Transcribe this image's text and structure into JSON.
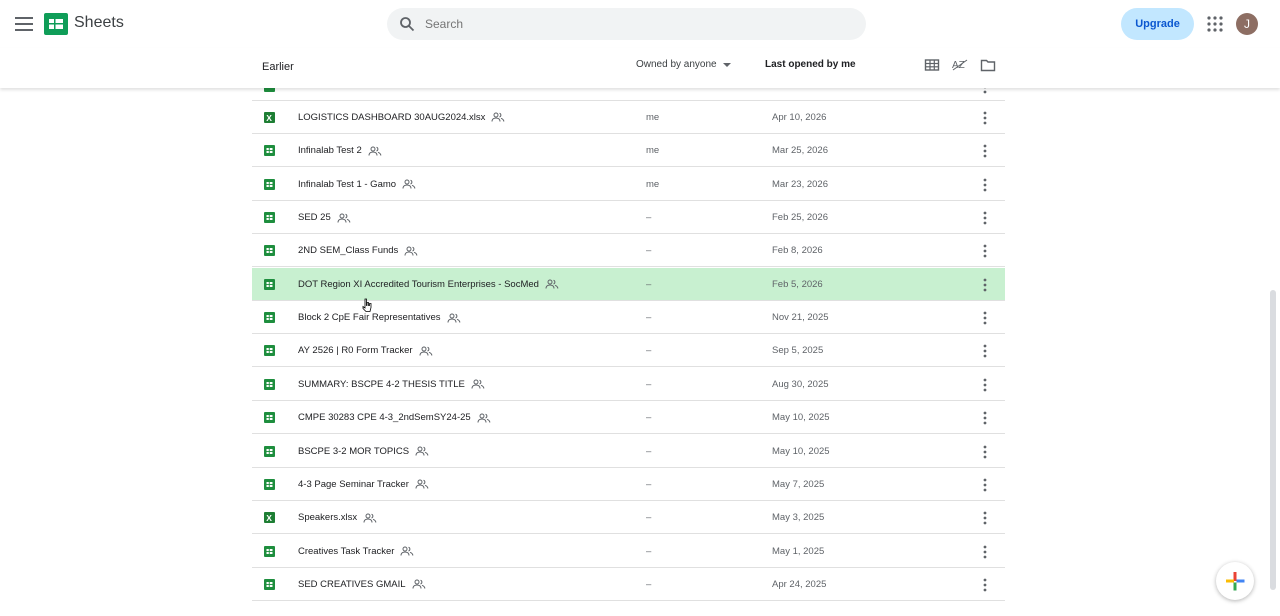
{
  "app": {
    "title": "Sheets"
  },
  "search": {
    "placeholder": "Search"
  },
  "header": {
    "upgrade_label": "Upgrade",
    "avatar_initial": "J"
  },
  "toolbar": {
    "section_title": "Earlier",
    "owner_filter": "Owned by anyone",
    "sort_label": "Last opened by me"
  },
  "colors": {
    "sheets_green": "#1e8e3e",
    "excel_green": "#1e7e34",
    "selected_row": "#c8f0d0",
    "upgrade_bg": "#c2e7ff"
  },
  "files": [
    {
      "name": "LOGISTICS DASHBOARD 30AUG2024.xlsx",
      "type": "excel",
      "owner": "me",
      "date": "Apr 10, 2026"
    },
    {
      "name": "Infinalab Test 2",
      "type": "sheets",
      "owner": "me",
      "date": "Mar 25, 2026"
    },
    {
      "name": "Infinalab Test 1 - Gamo",
      "type": "sheets",
      "owner": "me",
      "date": "Mar 23, 2026"
    },
    {
      "name": "SED 25",
      "type": "sheets",
      "owner": "–",
      "date": "Feb 25, 2026"
    },
    {
      "name": "2ND SEM_Class Funds",
      "type": "sheets",
      "owner": "–",
      "date": "Feb 8, 2026"
    },
    {
      "name": "DOT Region XI Accredited Tourism Enterprises - SocMed",
      "type": "sheets",
      "owner": "–",
      "date": "Feb 5, 2026",
      "selected": true
    },
    {
      "name": "Block 2 CpE Fair Representatives",
      "type": "sheets",
      "owner": "–",
      "date": "Nov 21, 2025"
    },
    {
      "name": "AY 2526 | R0 Form Tracker",
      "type": "sheets",
      "owner": "–",
      "date": "Sep 5, 2025"
    },
    {
      "name": "SUMMARY: BSCPE 4-2 THESIS TITLE",
      "type": "sheets",
      "owner": "–",
      "date": "Aug 30, 2025"
    },
    {
      "name": "CMPE 30283 CPE 4-3_2ndSemSY24-25",
      "type": "sheets",
      "owner": "–",
      "date": "May 10, 2025"
    },
    {
      "name": "BSCPE 3-2 MOR TOPICS",
      "type": "sheets",
      "owner": "–",
      "date": "May 10, 2025"
    },
    {
      "name": "4-3 Page Seminar Tracker",
      "type": "sheets",
      "owner": "–",
      "date": "May 7, 2025"
    },
    {
      "name": "Speakers.xlsx",
      "type": "excel",
      "owner": "–",
      "date": "May 3, 2025"
    },
    {
      "name": "Creatives Task Tracker",
      "type": "sheets",
      "owner": "–",
      "date": "May 1, 2025"
    },
    {
      "name": "SED CREATIVES GMAIL",
      "type": "sheets",
      "owner": "–",
      "date": "Apr 24, 2025"
    }
  ]
}
